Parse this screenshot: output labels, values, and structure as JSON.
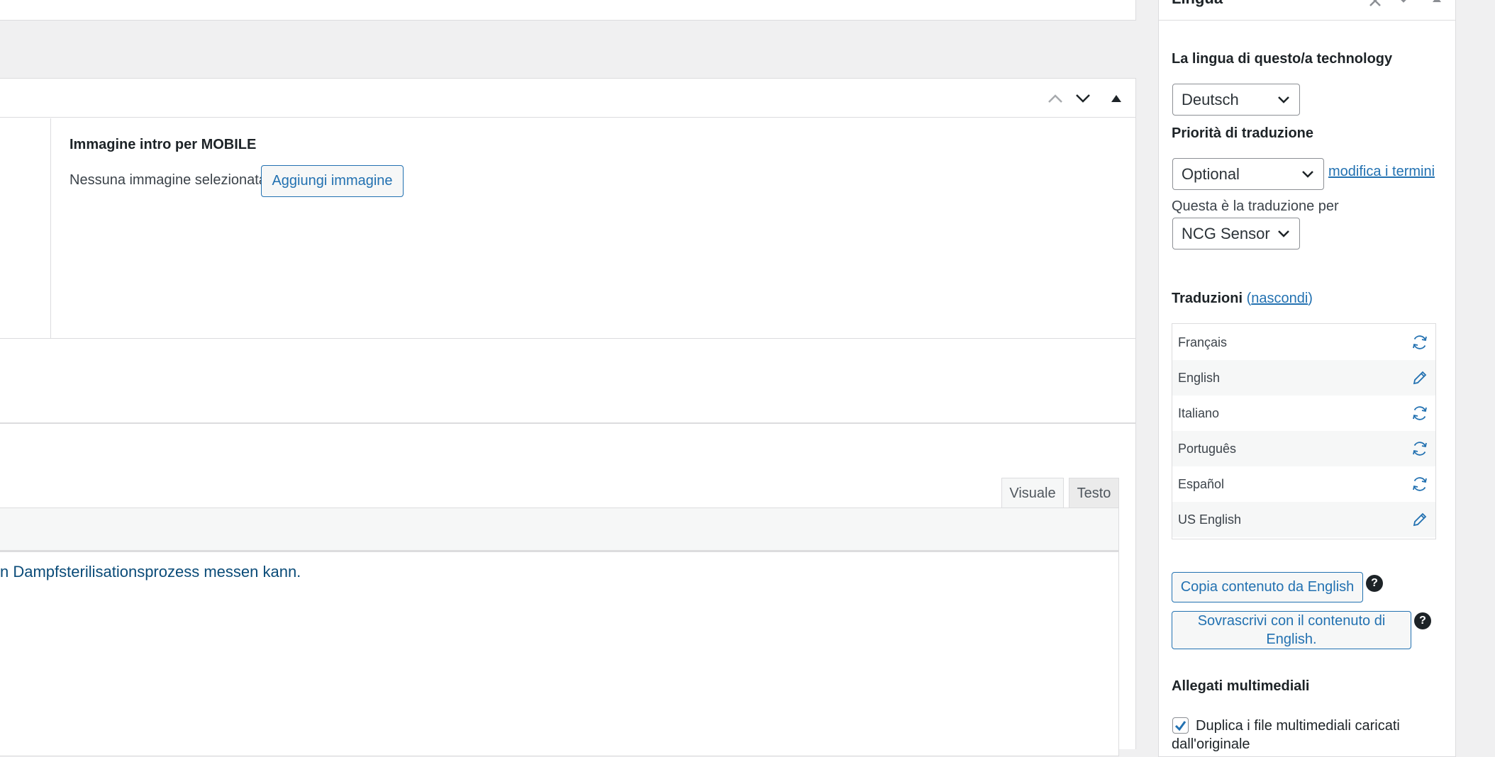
{
  "metabox": {
    "field_label": "Immagine intro per MOBILE",
    "no_image_text": "Nessuna immagine selezionata",
    "add_image_button": "Aggiungi immagine"
  },
  "editor": {
    "tab_visual": "Visuale",
    "tab_text": "Testo",
    "content_text": "n Dampfsterilisationsprozess messen kann."
  },
  "sidebar": {
    "title": "Lingua",
    "language_label": "La lingua di questo/a technology",
    "language_value": "Deutsch",
    "priority_label": "Priorità di traduzione",
    "priority_value": "Optional",
    "edit_terms_link": "modifica i termini",
    "translation_of_label": "Questa è la traduzione per",
    "translation_of_value": "NCG Sensor",
    "translations_heading": "Traduzioni",
    "hide_link": "nascondi",
    "translations": [
      {
        "language": "Français",
        "icon": "sync-icon"
      },
      {
        "language": "English",
        "icon": "pencil-icon"
      },
      {
        "language": "Italiano",
        "icon": "sync-icon"
      },
      {
        "language": "Português",
        "icon": "sync-icon"
      },
      {
        "language": "Español",
        "icon": "sync-icon"
      },
      {
        "language": "US English",
        "icon": "pencil-icon"
      }
    ],
    "copy_content_button": "Copia contenuto da English",
    "overwrite_button": "Sovrascrivi con il contenuto di English.",
    "media_heading": "Allegati multimediali",
    "duplicate_media_label": "Duplica i file multimediali caricati dall'originale",
    "help_glyph": "?"
  },
  "colors": {
    "accent": "#2271b1",
    "editor_text": "#0a4b78",
    "background": "#f0f0f1"
  }
}
